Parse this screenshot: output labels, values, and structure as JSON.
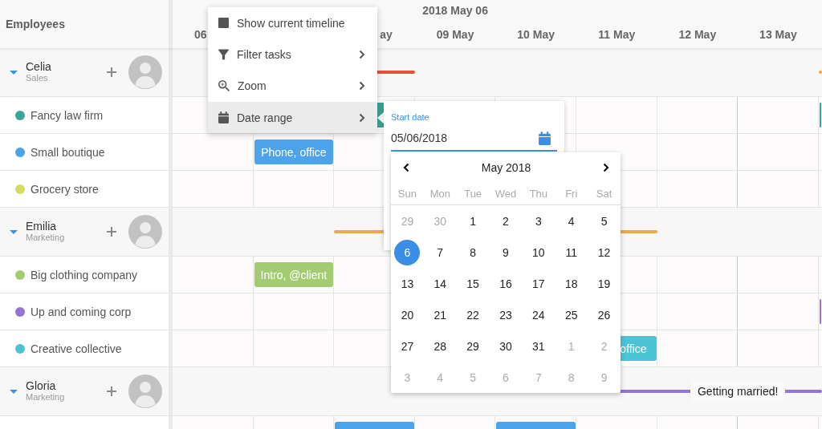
{
  "header": {
    "sidebar_title": "Employees",
    "range_title": "2018 May 06",
    "days": [
      {
        "label": "06",
        "kind": "head"
      },
      {
        "label": "ay",
        "kind": "tail"
      },
      {
        "label": "09 May",
        "kind": "full"
      },
      {
        "label": "10 May",
        "kind": "full"
      },
      {
        "label": "11 May",
        "kind": "full"
      },
      {
        "label": "12 May",
        "kind": "full"
      },
      {
        "label": "13 May",
        "kind": "full"
      }
    ]
  },
  "employees": [
    {
      "name": "Celia",
      "department": "Sales",
      "expanded": true,
      "tasks": [
        {
          "kind": "line",
          "color": "#e8503a"
        },
        {
          "kind": "line",
          "color": "#f5a742"
        }
      ],
      "customers": [
        {
          "name": "Fancy law firm",
          "color": "#3aa597",
          "tasks": [
            {
              "kind": "block",
              "color": "#3aa597"
            },
            {
              "kind": "block",
              "color": "#3aa597"
            }
          ]
        },
        {
          "name": "Small boutique",
          "color": "#4da3ea",
          "tasks": [
            {
              "kind": "block",
              "color": "#4da3ea",
              "label": "Phone, office"
            }
          ]
        },
        {
          "name": "Grocery store",
          "color": "#d5dc62"
        }
      ]
    },
    {
      "name": "Emilia",
      "department": "Marketing",
      "expanded": true,
      "tasks": [
        {
          "kind": "line",
          "color": "#f5a742"
        }
      ],
      "customers": [
        {
          "name": "Big clothing company",
          "color": "#a3cc72",
          "tasks": [
            {
              "kind": "block",
              "color": "#a3cc72",
              "label": "Intro, @client"
            }
          ]
        },
        {
          "name": "Up and coming corp",
          "color": "#9575cd",
          "tasks": [
            {
              "kind": "block",
              "color": "#9575cd"
            }
          ]
        },
        {
          "name": "Creative collective",
          "color": "#4dc3d6",
          "tasks": [
            {
              "kind": "tail",
              "color": "#4dc3d6",
              "label": "office"
            }
          ]
        }
      ]
    },
    {
      "name": "Gloria",
      "department": "Marketing",
      "expanded": true,
      "tasks": [
        {
          "kind": "line",
          "color": "#9575cd",
          "label": "Getting married!"
        }
      ],
      "customers": [
        {
          "tasks": [
            {
              "kind": "block",
              "color": "#4da3ea"
            },
            {
              "kind": "block",
              "color": "#4da3ea"
            }
          ]
        }
      ]
    }
  ],
  "context_menu": {
    "items": [
      {
        "label": "Show current timeline",
        "submenu": false,
        "selected": false
      },
      {
        "label": "Filter tasks",
        "submenu": true,
        "selected": false
      },
      {
        "label": "Zoom",
        "submenu": true,
        "selected": false
      },
      {
        "label": "Date range",
        "submenu": true,
        "selected": true
      }
    ]
  },
  "date_picker": {
    "label": "Start date",
    "value": "05/06/2018",
    "calendar": {
      "title": "May 2018",
      "weekdays": [
        "Sun",
        "Mon",
        "Tue",
        "Wed",
        "Thu",
        "Fri",
        "Sat"
      ],
      "weeks": [
        [
          {
            "day": "29",
            "outside": true,
            "selected": false
          },
          {
            "day": "30",
            "outside": true,
            "selected": false
          },
          {
            "day": "1",
            "outside": false,
            "selected": false
          },
          {
            "day": "2",
            "outside": false,
            "selected": false
          },
          {
            "day": "3",
            "outside": false,
            "selected": false
          },
          {
            "day": "4",
            "outside": false,
            "selected": false
          },
          {
            "day": "5",
            "outside": false,
            "selected": false
          }
        ],
        [
          {
            "day": "6",
            "outside": false,
            "selected": true
          },
          {
            "day": "7",
            "outside": false,
            "selected": false
          },
          {
            "day": "8",
            "outside": false,
            "selected": false
          },
          {
            "day": "9",
            "outside": false,
            "selected": false
          },
          {
            "day": "10",
            "outside": false,
            "selected": false
          },
          {
            "day": "11",
            "outside": false,
            "selected": false
          },
          {
            "day": "12",
            "outside": false,
            "selected": false
          }
        ],
        [
          {
            "day": "13",
            "outside": false,
            "selected": false
          },
          {
            "day": "14",
            "outside": false,
            "selected": false
          },
          {
            "day": "15",
            "outside": false,
            "selected": false
          },
          {
            "day": "16",
            "outside": false,
            "selected": false
          },
          {
            "day": "17",
            "outside": false,
            "selected": false
          },
          {
            "day": "18",
            "outside": false,
            "selected": false
          },
          {
            "day": "19",
            "outside": false,
            "selected": false
          }
        ],
        [
          {
            "day": "20",
            "outside": false,
            "selected": false
          },
          {
            "day": "21",
            "outside": false,
            "selected": false
          },
          {
            "day": "22",
            "outside": false,
            "selected": false
          },
          {
            "day": "23",
            "outside": false,
            "selected": false
          },
          {
            "day": "24",
            "outside": false,
            "selected": false
          },
          {
            "day": "25",
            "outside": false,
            "selected": false
          },
          {
            "day": "26",
            "outside": false,
            "selected": false
          }
        ],
        [
          {
            "day": "27",
            "outside": false,
            "selected": false
          },
          {
            "day": "28",
            "outside": false,
            "selected": false
          },
          {
            "day": "29",
            "outside": false,
            "selected": false
          },
          {
            "day": "30",
            "outside": false,
            "selected": false
          },
          {
            "day": "31",
            "outside": false,
            "selected": false
          },
          {
            "day": "1",
            "outside": true,
            "selected": false
          },
          {
            "day": "2",
            "outside": true,
            "selected": false
          }
        ],
        [
          {
            "day": "3",
            "outside": true,
            "selected": false
          },
          {
            "day": "4",
            "outside": true,
            "selected": false
          },
          {
            "day": "5",
            "outside": true,
            "selected": false
          },
          {
            "day": "6",
            "outside": true,
            "selected": false
          },
          {
            "day": "7",
            "outside": true,
            "selected": false
          },
          {
            "day": "8",
            "outside": true,
            "selected": false
          },
          {
            "day": "9",
            "outside": true,
            "selected": false
          }
        ]
      ]
    }
  }
}
